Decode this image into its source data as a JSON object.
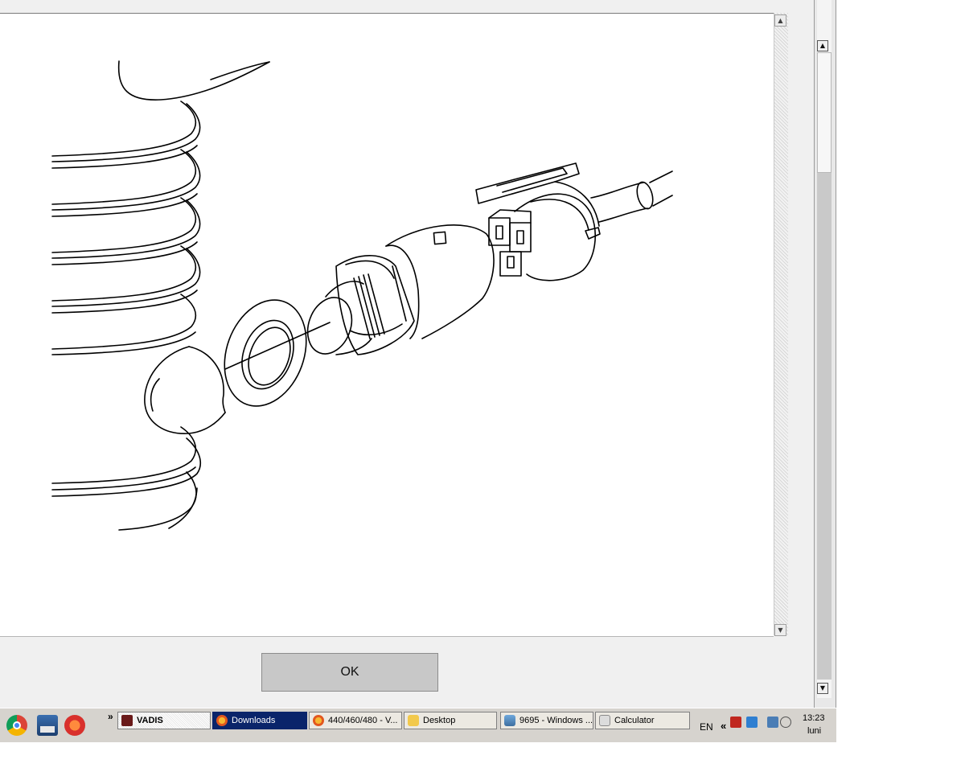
{
  "dialog": {
    "ok_label": "OK",
    "image_name": "exploded-sensor-diagram"
  },
  "scrollbars": {
    "up_arrow": "▲",
    "down_arrow": "▼"
  },
  "taskbar": {
    "quick_launch": [
      "chrome-icon",
      "media-center-icon",
      "burn-app-icon"
    ],
    "chevron": "»",
    "buttons": [
      {
        "label": "VADIS",
        "icon": "vadis-icon",
        "state": "pressed"
      },
      {
        "label": "Downloads",
        "icon": "firefox-icon",
        "state": "active"
      },
      {
        "label": "440/460/480 - V...",
        "icon": "firefox-icon",
        "state": "normal"
      },
      {
        "label": "Desktop",
        "icon": "folder-icon",
        "state": "normal"
      },
      {
        "label": "9695 - Windows ...",
        "icon": "picture-viewer-icon",
        "state": "normal"
      },
      {
        "label": "Calculator",
        "icon": "calculator-icon",
        "state": "normal"
      }
    ],
    "tray": {
      "language": "EN",
      "chevron": "«",
      "time": "13:23",
      "day": "luni"
    }
  },
  "colors": {
    "active_task": "#0a246a",
    "taskbar": "#d6d3ce",
    "ok_button": "#c8c8c8"
  }
}
